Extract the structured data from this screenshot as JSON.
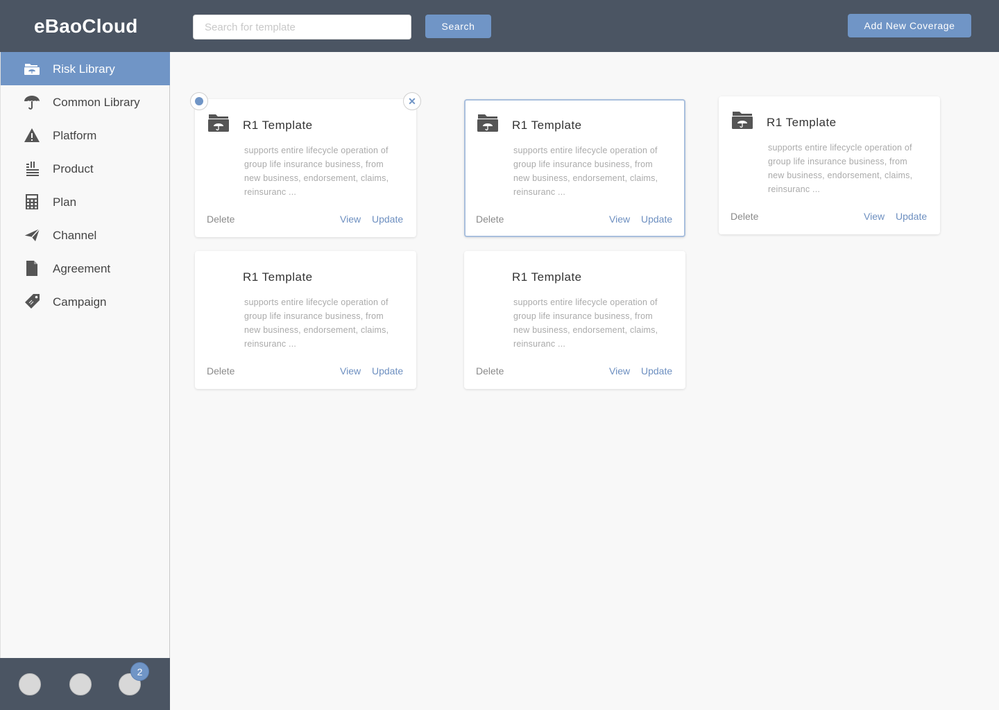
{
  "app": {
    "brand": "eBaoCloud"
  },
  "header": {
    "search_placeholder": "Search for template",
    "search_label": "Search",
    "add_label": "Add New Coverage"
  },
  "sidebar": {
    "items": [
      {
        "label": "Risk Library",
        "icon": "folder-umbrella-icon",
        "active": true
      },
      {
        "label": "Common Library",
        "icon": "umbrella-icon",
        "active": false
      },
      {
        "label": "Platform",
        "icon": "warning-icon",
        "active": false
      },
      {
        "label": "Product",
        "icon": "list-icon",
        "active": false
      },
      {
        "label": "Plan",
        "icon": "calculator-icon",
        "active": false
      },
      {
        "label": "Channel",
        "icon": "paper-plane-icon",
        "active": false
      },
      {
        "label": "Agreement",
        "icon": "document-icon",
        "active": false
      },
      {
        "label": "Campaign",
        "icon": "tag-icon",
        "active": false
      }
    ]
  },
  "footer": {
    "badge_count": "2"
  },
  "cards": [
    {
      "title": "R1 Template",
      "desc": "supports entire lifecycle operation of group life insurance business, from new business, endorsement, claims, reinsuranc ...",
      "delete": "Delete",
      "view": "View",
      "update": "Update",
      "has_icon": true
    },
    {
      "title": "R1 Template",
      "desc": "supports entire lifecycle operation of group life insurance business, from new business, endorsement, claims, reinsuranc ...",
      "delete": "Delete",
      "view": "View",
      "update": "Update",
      "has_icon": true,
      "selected": true
    },
    {
      "title": "R1 Template",
      "desc": "supports entire lifecycle operation of group life insurance business, from new business, endorsement, claims, reinsuranc ...",
      "delete": "Delete",
      "view": "View",
      "update": "Update",
      "has_icon": true
    },
    {
      "title": "R1 Template",
      "desc": "supports entire lifecycle operation of group life insurance business, from new business, endorsement, claims, reinsuranc ...",
      "delete": "Delete",
      "view": "View",
      "update": "Update",
      "has_icon": false
    },
    {
      "title": "R1 Template",
      "desc": "supports entire lifecycle operation of group life insurance business, from new business, endorsement, claims, reinsuranc ...",
      "delete": "Delete",
      "view": "View",
      "update": "Update",
      "has_icon": false
    }
  ],
  "colors": {
    "header_bg": "#4b5563",
    "accent": "#7095c6",
    "link": "#6d8fc0"
  }
}
